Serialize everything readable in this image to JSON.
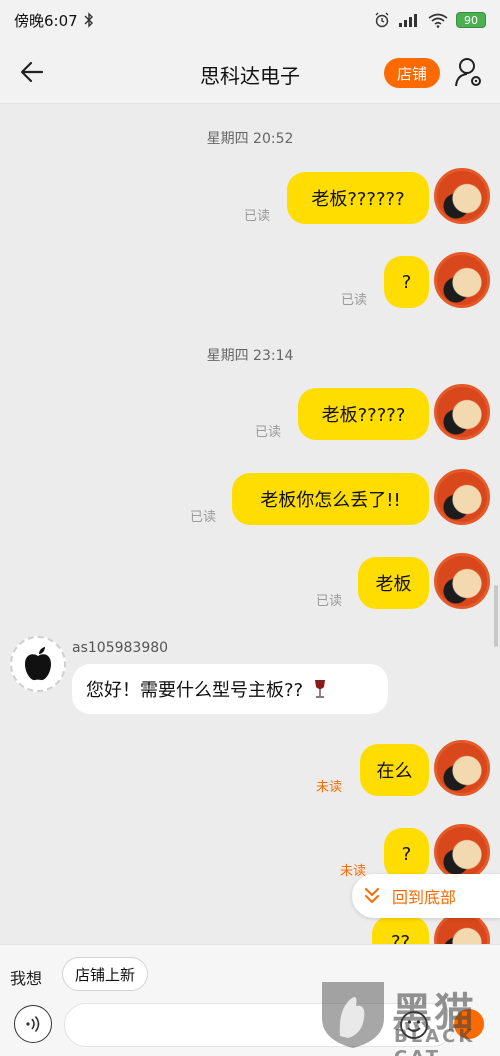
{
  "status_bar": {
    "time": "傍晚6:07",
    "battery": "90"
  },
  "header": {
    "title": "思科达电子",
    "shop_button": "店铺"
  },
  "chat": {
    "timestamps": [
      "星期四 20:52",
      "星期四 23:14"
    ],
    "messages": [
      {
        "text": "老板??????",
        "status": "已读"
      },
      {
        "text": "?",
        "status": "已读"
      },
      {
        "text": "老板?????",
        "status": "已读"
      },
      {
        "text": "老板你怎么丢了!!",
        "status": "已读"
      },
      {
        "text": "老板",
        "status": "已读"
      },
      {
        "sender": "as105983980",
        "text": "您好！需要什么型号主板??"
      },
      {
        "text": "在么",
        "status": "未读"
      },
      {
        "text": "?",
        "status": "未读"
      },
      {
        "text": "??"
      }
    ]
  },
  "scroll_to_bottom": {
    "label": "回到底部"
  },
  "footer": {
    "wish_label": "我想",
    "chip_label": "店铺上新"
  },
  "watermark": {
    "cn": "黑猫",
    "en": "BLACK CAT"
  },
  "colors": {
    "accent": "#ff6a00",
    "bubble_me": "#ffdd00",
    "bubble_other": "#ffffff",
    "background": "#ececec"
  }
}
